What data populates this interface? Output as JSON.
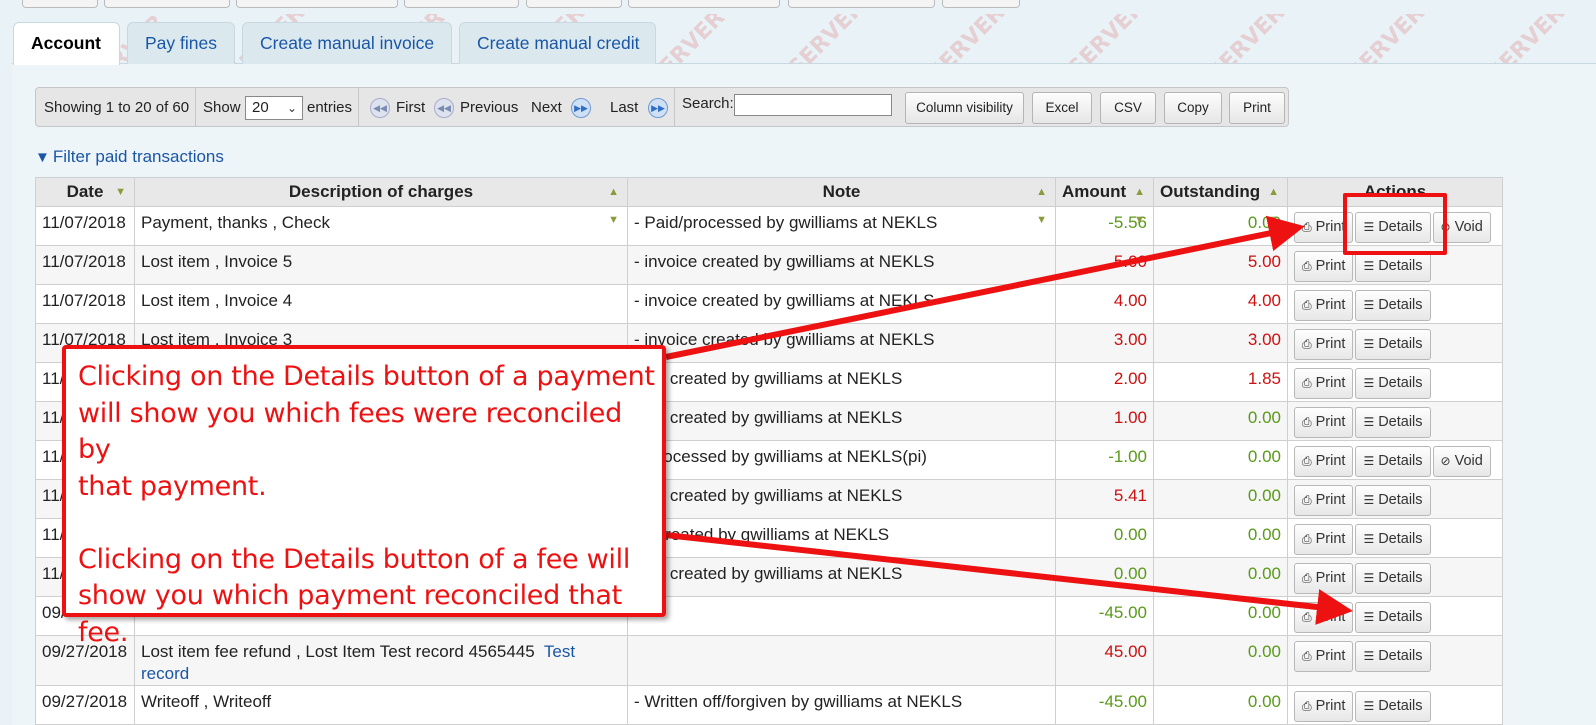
{
  "watermark_text": "TEST SERVER",
  "tabs": [
    {
      "label": "Account",
      "active": true
    },
    {
      "label": "Pay fines",
      "active": false
    },
    {
      "label": "Create manual invoice",
      "active": false
    },
    {
      "label": "Create manual credit",
      "active": false
    }
  ],
  "pager": {
    "showing": "Showing 1 to 20 of 60",
    "show_label": "Show",
    "page_size": "20",
    "entries_label": "entries",
    "first": "First",
    "previous": "Previous",
    "next": "Next",
    "last": "Last",
    "search_label": "Search:",
    "search_value": "",
    "buttons": {
      "column_visibility": "Column visibility",
      "excel": "Excel",
      "csv": "CSV",
      "copy": "Copy",
      "print": "Print"
    }
  },
  "filter_link": "Filter paid transactions",
  "table": {
    "headers": {
      "date": "Date",
      "description": "Description of charges",
      "note": "Note",
      "amount": "Amount",
      "outstanding": "Outstanding",
      "actions": "Actions"
    },
    "action_labels": {
      "print": "Print",
      "details": "Details",
      "void": "Void"
    },
    "rows": [
      {
        "date": "11/07/2018",
        "description": "Payment, thanks , Check",
        "note": "- Paid/processed by gwilliams at NEKLS",
        "amount": "-5.56",
        "amount_color": "green",
        "outstanding": "0.00",
        "outstanding_color": "green",
        "void": true
      },
      {
        "date": "11/07/2018",
        "description": "Lost item , Invoice 5",
        "note": "- invoice created by gwilliams at NEKLS",
        "amount": "5.00",
        "amount_color": "red",
        "outstanding": "5.00",
        "outstanding_color": "red",
        "void": false
      },
      {
        "date": "11/07/2018",
        "description": "Lost item , Invoice 4",
        "note": "- invoice created by gwilliams at NEKLS",
        "amount": "4.00",
        "amount_color": "red",
        "outstanding": "4.00",
        "outstanding_color": "red",
        "void": false
      },
      {
        "date": "11/07/2018",
        "description": "Lost item , Invoice 3",
        "note": "- invoice created by gwilliams at NEKLS",
        "amount": "3.00",
        "amount_color": "red",
        "outstanding": "3.00",
        "outstanding_color": "red",
        "void": false
      },
      {
        "date": "11/",
        "description": "",
        "note": "oice created by gwilliams at NEKLS",
        "amount": "2.00",
        "amount_color": "red",
        "outstanding": "1.85",
        "outstanding_color": "red",
        "void": false
      },
      {
        "date": "11/",
        "description": "",
        "note": "oice created by gwilliams at NEKLS",
        "amount": "1.00",
        "amount_color": "red",
        "outstanding": "0.00",
        "outstanding_color": "green",
        "void": false
      },
      {
        "date": "11/",
        "description": "",
        "note": "d/processed by gwilliams at NEKLS(pi)",
        "amount": "-1.00",
        "amount_color": "green",
        "outstanding": "0.00",
        "outstanding_color": "green",
        "void": true
      },
      {
        "date": "11/",
        "description": "",
        "note": "oice created by gwilliams at NEKLS",
        "amount": "5.41",
        "amount_color": "red",
        "outstanding": "0.00",
        "outstanding_color": "green",
        "void": false
      },
      {
        "date": "11/",
        "description": "",
        "note": "dit created by gwilliams at NEKLS",
        "amount": "0.00",
        "amount_color": "green",
        "outstanding": "0.00",
        "outstanding_color": "green",
        "void": false
      },
      {
        "date": "11/",
        "description": "",
        "note": "oice created by gwilliams at NEKLS",
        "amount": "0.00",
        "amount_color": "green",
        "outstanding": "0.00",
        "outstanding_color": "green",
        "void": false
      },
      {
        "date": "09/",
        "description": "",
        "note": "",
        "amount": "-45.00",
        "amount_color": "green",
        "outstanding": "0.00",
        "outstanding_color": "green",
        "void": false
      },
      {
        "date": "09/27/2018",
        "description": "Lost item fee refund , Lost Item Test record 4565445",
        "description_link": "Test record",
        "note": "",
        "amount": "45.00",
        "amount_color": "red",
        "outstanding": "0.00",
        "outstanding_color": "green",
        "void": false
      },
      {
        "date": "09/27/2018",
        "description": "Writeoff , Writeoff",
        "note": "- Written off/forgiven by gwilliams at NEKLS",
        "amount": "-45.00",
        "amount_color": "green",
        "outstanding": "0.00",
        "outstanding_color": "green",
        "void": false
      }
    ]
  },
  "callout": {
    "line1": "Clicking on the Details button of a payment",
    "line2": "will show you which fees were reconciled by",
    "line3": "that payment.",
    "line4": "Clicking on the Details button of a fee will",
    "line5": "show you which payment reconciled that fee."
  },
  "annotation_color": "#ee1111"
}
